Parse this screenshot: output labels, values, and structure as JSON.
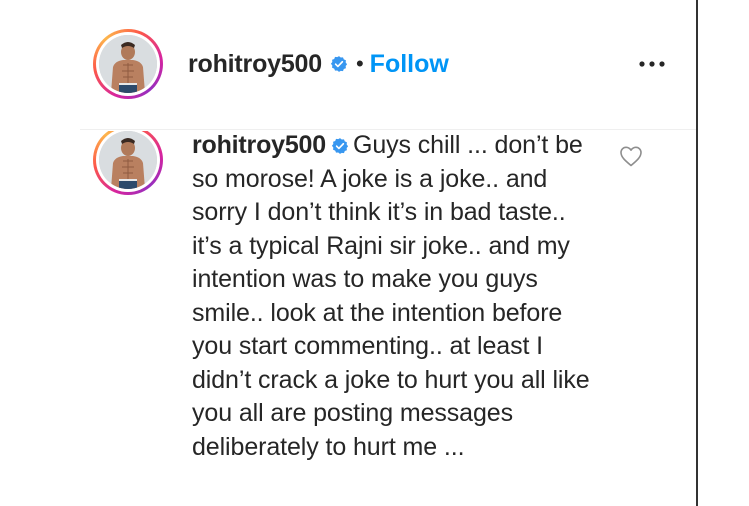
{
  "post_header": {
    "username": "rohitroy500",
    "separator": "•",
    "follow_label": "Follow",
    "more_icon": "ellipsis-icon",
    "verified_icon": "verified-badge-icon"
  },
  "comment": {
    "username": "rohitroy500",
    "verified_icon": "verified-badge-icon",
    "text": "Guys chill ... don’t be so morose! A joke is a joke.. and sorry I don’t think it’s in bad taste.. it’s a typical Rajni sir joke.. and my intention was to make you guys smile.. look at the intention before you start commenting.. at least I didn’t crack a joke to hurt you all like you all are posting messages deliberately to hurt me ...",
    "like_icon": "heart-outline-icon"
  },
  "colors": {
    "follow": "#0095f6",
    "verified": "#3897f0",
    "text": "#262626",
    "divider": "#efefef"
  }
}
